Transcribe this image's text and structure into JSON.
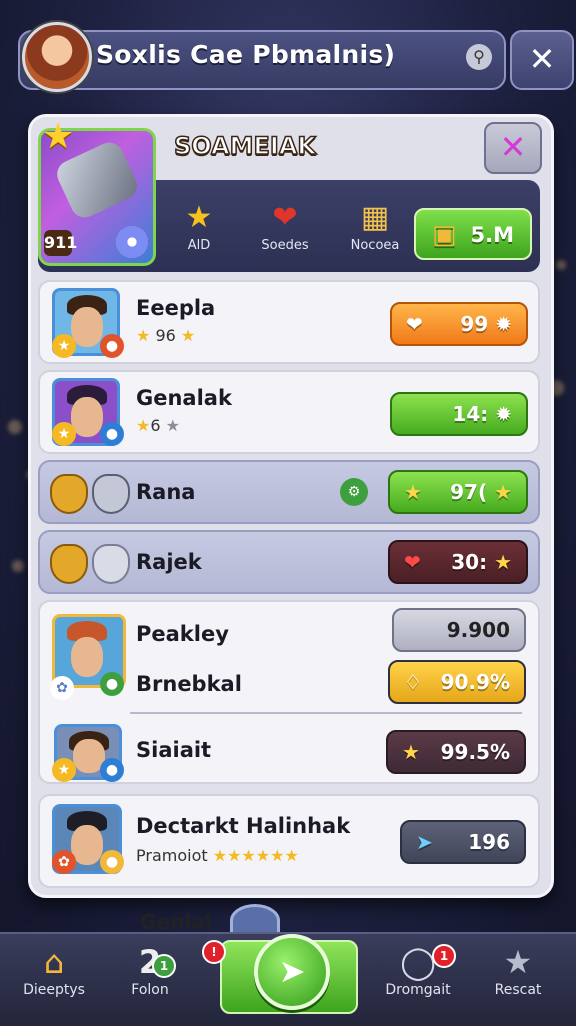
{
  "topbar": {
    "title": "Soxlis Cae Pbmalnis)"
  },
  "header": {
    "title": "SOAMEIAK",
    "hero_level": "911",
    "stats": [
      {
        "icon": "star",
        "label": "AlD"
      },
      {
        "icon": "heart",
        "label": "Soedes"
      },
      {
        "icon": "card",
        "label": "Nocoea"
      }
    ],
    "coins": "5.M"
  },
  "rows": [
    {
      "name": "Eeepla",
      "sub": "96",
      "value": "99"
    },
    {
      "name": "Genalak",
      "sub": "6",
      "value": "14:"
    },
    {
      "name": "Rana",
      "value": "97("
    },
    {
      "name": "Rajek",
      "value": "30:"
    },
    {
      "name": "Peakley",
      "value": "9.900"
    },
    {
      "name": "Brnebkal",
      "value": "90.9%"
    },
    {
      "name": "Siaiait",
      "value": "99.5%"
    },
    {
      "name": "Dectarkt Halinhak",
      "sub": "Pramoiot",
      "value": "196"
    }
  ],
  "peek_label": "Genlal",
  "bottom_nav": [
    {
      "label": "Dieeptys",
      "icon": "home"
    },
    {
      "label": "Folon",
      "icon": "number",
      "badge": ""
    },
    {
      "label": "",
      "icon": "play",
      "badge": "!"
    },
    {
      "label": "Dromgait",
      "icon": "chat",
      "badge": "1"
    },
    {
      "label": "Rescat",
      "icon": "star"
    }
  ],
  "nav_badge_folon": "2",
  "colors": {
    "accent_green": "#46ab1f",
    "accent_orange": "#f07a1a",
    "panel": "#dfe0ea"
  }
}
